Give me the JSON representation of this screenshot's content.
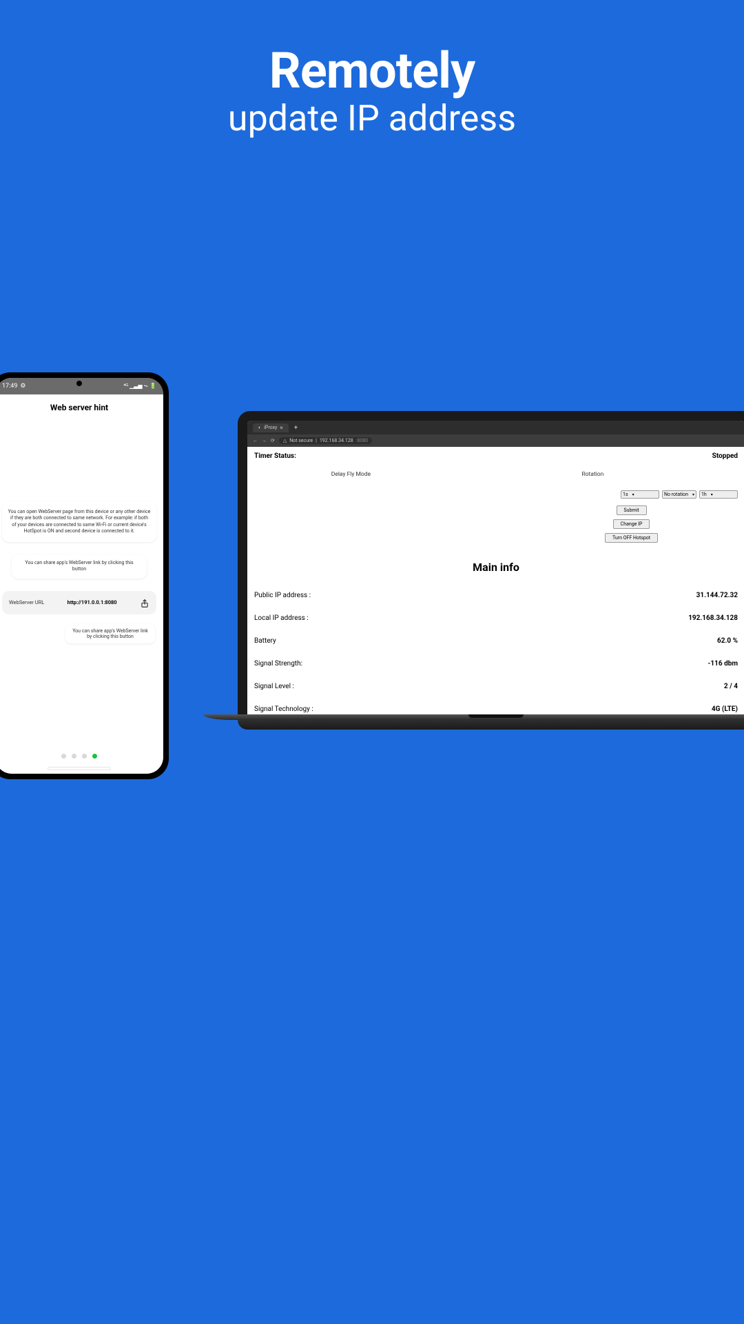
{
  "header": {
    "title": "Remotely",
    "subtitle": "update IP address"
  },
  "phone": {
    "status_time": "17:49",
    "status_icons": "⚙",
    "network_icons": "⁴ᴳ ▁▃▅ ⏦ 🔋",
    "page_title": "Web server hint",
    "hint1": "You can open WebServer page from this device or any other device if they are both connected to same network. For example: if both of your devices are connected to same Wi-Fi or current device's HotSpot is ON and second device is connected to it.",
    "hint2": "You can share app's WebServer link by clicking this button",
    "url_label": "WebServer URL",
    "url_value": "http://191.0.0.1:8080",
    "hint3": "You can share app's WebServer link by clicking this button"
  },
  "laptop": {
    "tab_name": "iProxy",
    "not_secure": "Not secure",
    "url_host": "192.168.34.128",
    "url_port": ":8080",
    "timer_status_label": "Timer Status:",
    "timer_status_value": "Stopped",
    "delay_header": "Delay Fly Mode",
    "rotation_header": "Rotation",
    "sel_delay": "1s",
    "sel_rotation": "No rotation",
    "sel_interval": "1h",
    "btn_submit": "Submit",
    "btn_change_ip": "Change IP",
    "btn_hotspot": "Turn OFF Hotspot",
    "main_info": "Main info",
    "rows": [
      {
        "label": "Public IP address :",
        "value": "31.144.72.32"
      },
      {
        "label": "Local IP address :",
        "value": "192.168.34.128"
      },
      {
        "label": "Battery",
        "value": "62.0 %"
      },
      {
        "label": "Signal Strength:",
        "value": "-116 dbm"
      },
      {
        "label": "Signal Level :",
        "value": "2 / 4"
      },
      {
        "label": "Signal Technology :",
        "value": "4G (LTE)"
      }
    ]
  }
}
